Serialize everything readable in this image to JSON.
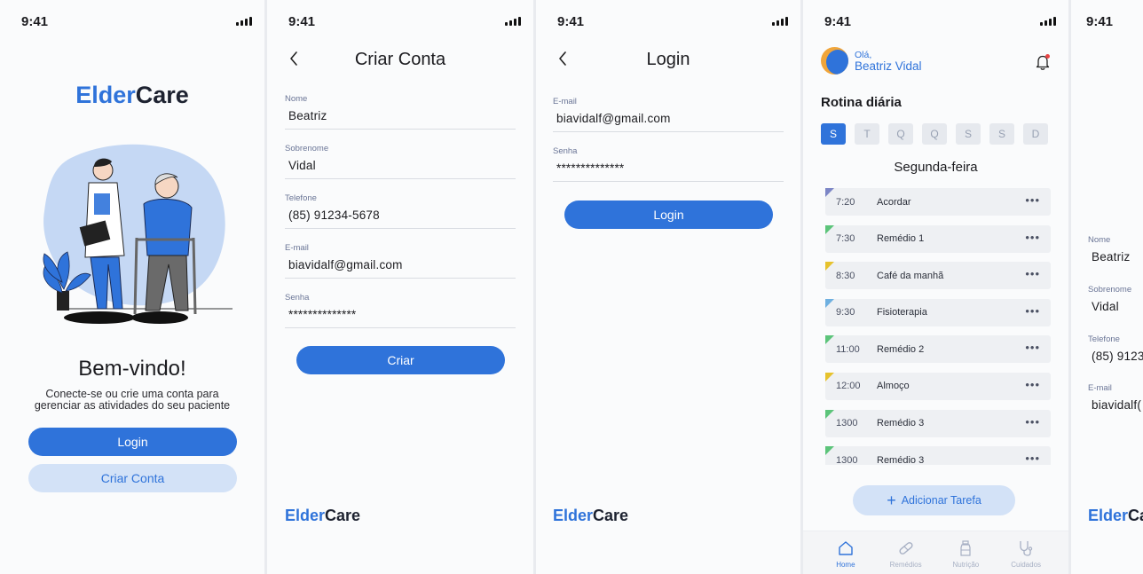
{
  "status_time": "9:41",
  "brand": {
    "part1": "Elder",
    "part2": "Care"
  },
  "welcome": {
    "title": "Bem-vindo!",
    "subtitle": "Conecte-se ou crie uma conta para gerenciar as atividades do seu paciente",
    "login_label": "Login",
    "signup_label": "Criar Conta"
  },
  "signup": {
    "title": "Criar Conta",
    "fields": [
      {
        "label": "Nome",
        "value": "Beatriz"
      },
      {
        "label": "Sobrenome",
        "value": "Vidal"
      },
      {
        "label": "Telefone",
        "value": "(85) 91234-5678"
      },
      {
        "label": "E-mail",
        "value": "biavidalf@gmail.com"
      },
      {
        "label": "Senha",
        "value": "**************"
      }
    ],
    "submit_label": "Criar"
  },
  "login": {
    "title": "Login",
    "fields": [
      {
        "label": "E-mail",
        "value": "biavidalf@gmail.com"
      },
      {
        "label": "Senha",
        "value": "**************"
      }
    ],
    "submit_label": "Login"
  },
  "home": {
    "greeting": "Olá,",
    "user_name": "Beatriz Vidal",
    "routine_title": "Rotina diária",
    "days": [
      "S",
      "T",
      "Q",
      "Q",
      "S",
      "S",
      "D"
    ],
    "active_day_index": 0,
    "day_title": "Segunda-feira",
    "tasks": [
      {
        "time": "7:20",
        "name": "Acordar",
        "color": "#7c86c6"
      },
      {
        "time": "7:30",
        "name": "Remédio 1",
        "color": "#5cc47a"
      },
      {
        "time": "8:30",
        "name": "Café da manhã",
        "color": "#e6c22e"
      },
      {
        "time": "9:30",
        "name": "Fisioterapia",
        "color": "#6fb0e0"
      },
      {
        "time": "11:00",
        "name": "Remédio 2",
        "color": "#5cc47a"
      },
      {
        "time": "12:00",
        "name": "Almoço",
        "color": "#e6c22e"
      },
      {
        "time": "1300",
        "name": "Remédio 3",
        "color": "#5cc47a"
      },
      {
        "time": "1300",
        "name": "Remédio 3",
        "color": "#5cc47a"
      }
    ],
    "task_menu_glyph": "•••",
    "add_task_label": "Adicionar Tarefa",
    "tabs": [
      {
        "label": "Home",
        "icon": "home-icon"
      },
      {
        "label": "Remédios",
        "icon": "pill-icon"
      },
      {
        "label": "Nutrição",
        "icon": "bottle-icon"
      },
      {
        "label": "Cuidados",
        "icon": "stethoscope-icon"
      }
    ]
  },
  "partial_screen": {
    "fields": [
      {
        "label": "Nome",
        "value": "Beatriz"
      },
      {
        "label": "Sobrenome",
        "value": "Vidal"
      },
      {
        "label": "Telefone",
        "value": "(85) 9123"
      },
      {
        "label": "E-mail",
        "value": "biavidalf("
      }
    ],
    "brand_part1": "Elder",
    "brand_part2": "Ca"
  },
  "colors": {
    "primary": "#2f73da",
    "secondary_bg": "#d3e2f7",
    "text": "#1b1b1f"
  }
}
